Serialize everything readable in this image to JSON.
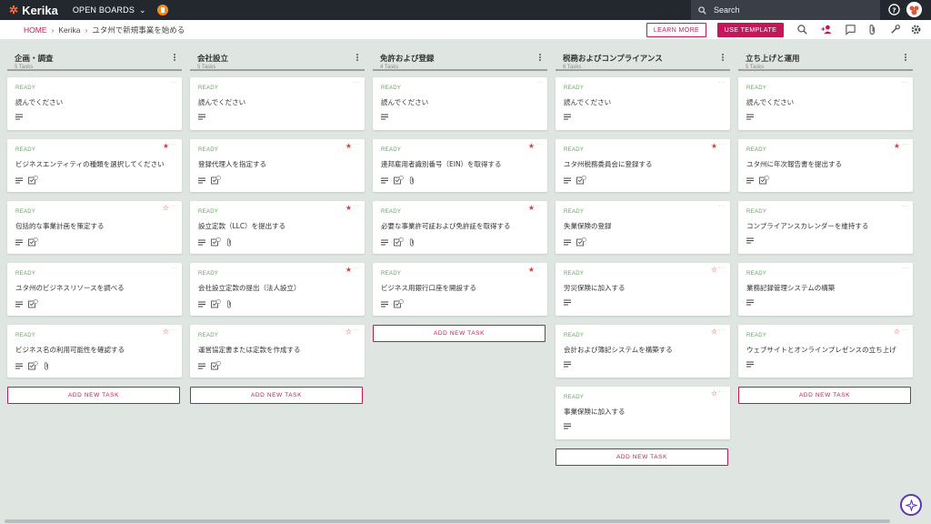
{
  "topbar": {
    "logo": "Kerika",
    "open_boards": "OPEN BOARDS",
    "search_placeholder": "Search"
  },
  "subbar": {
    "breadcrumb": [
      "HOME",
      "Kerika",
      "ユタ州で新規事業を始める"
    ],
    "learn_more": "LEARN MORE",
    "use_template": "USE TEMPLATE"
  },
  "colors": {
    "accent": "#c2185b",
    "status_ready": "#5fa65a",
    "star": "#e53935",
    "topbar": "#23272e",
    "background": "#dfe6e2"
  },
  "add_task_label": "ADD NEW TASK",
  "columns": [
    {
      "title": "企画・調査",
      "count": "5 Tasks",
      "tasks": [
        {
          "status": "READY",
          "title": "読んでください",
          "star": "none",
          "icons": [
            "desc"
          ]
        },
        {
          "status": "READY",
          "title": "ビジネスエンティティの種類を選択してください",
          "star": "filled",
          "icons": [
            "desc",
            "checklist"
          ]
        },
        {
          "status": "READY",
          "title": "包括的な事業計画を策定する",
          "star": "outline",
          "icons": [
            "desc",
            "checklist"
          ]
        },
        {
          "status": "READY",
          "title": "ユタ州のビジネスリソースを調べる",
          "star": "none",
          "icons": [
            "desc",
            "checklist"
          ]
        },
        {
          "status": "READY",
          "title": "ビジネス名の利用可能性を確認する",
          "star": "outline",
          "icons": [
            "desc",
            "checklist",
            "attach"
          ]
        }
      ]
    },
    {
      "title": "会社設立",
      "count": "5 Tasks",
      "tasks": [
        {
          "status": "READY",
          "title": "読んでください",
          "star": "none",
          "icons": [
            "desc"
          ]
        },
        {
          "status": "READY",
          "title": "登録代理人を指定する",
          "star": "filled",
          "icons": [
            "desc",
            "checklist"
          ]
        },
        {
          "status": "READY",
          "title": "設立定款（LLC）を提出する",
          "star": "filled",
          "icons": [
            "desc",
            "checklist",
            "attach"
          ]
        },
        {
          "status": "READY",
          "title": "会社設立定款の提出（法人設立）",
          "star": "filled",
          "icons": [
            "desc",
            "checklist",
            "attach"
          ]
        },
        {
          "status": "READY",
          "title": "運営協定書または定款を作成する",
          "star": "outline",
          "icons": [
            "desc",
            "checklist"
          ]
        }
      ]
    },
    {
      "title": "免許および登録",
      "count": "4 Tasks",
      "tasks": [
        {
          "status": "READY",
          "title": "読んでください",
          "star": "none",
          "icons": [
            "desc"
          ]
        },
        {
          "status": "READY",
          "title": "連邦雇用者識別番号（EIN）を取得する",
          "star": "filled",
          "icons": [
            "desc",
            "checklist",
            "attach"
          ]
        },
        {
          "status": "READY",
          "title": "必要な事業許可証および免許証を取得する",
          "star": "filled",
          "icons": [
            "desc",
            "checklist",
            "attach"
          ]
        },
        {
          "status": "READY",
          "title": "ビジネス用銀行口座を開設する",
          "star": "filled",
          "icons": [
            "desc",
            "checklist"
          ]
        }
      ]
    },
    {
      "title": "税務およびコンプライアンス",
      "count": "6 Tasks",
      "tasks": [
        {
          "status": "READY",
          "title": "読んでください",
          "star": "none",
          "icons": [
            "desc"
          ]
        },
        {
          "status": "READY",
          "title": "ユタ州税務委員会に登録する",
          "star": "filled",
          "icons": [
            "desc",
            "checklist"
          ]
        },
        {
          "status": "READY",
          "title": "失業保険の登録",
          "star": "none",
          "icons": [
            "desc",
            "checklist"
          ]
        },
        {
          "status": "READY",
          "title": "労災保険に加入する",
          "star": "outline",
          "icons": [
            "desc"
          ]
        },
        {
          "status": "READY",
          "title": "会計および簿記システムを構築する",
          "star": "outline",
          "icons": [
            "desc"
          ]
        },
        {
          "status": "READY",
          "title": "事業保険に加入する",
          "star": "outline",
          "icons": [
            "desc"
          ]
        }
      ]
    },
    {
      "title": "立ち上げと運用",
      "count": "5 Tasks",
      "tasks": [
        {
          "status": "READY",
          "title": "読んでください",
          "star": "none",
          "icons": [
            "desc"
          ]
        },
        {
          "status": "READY",
          "title": "ユタ州に年次報告書を提出する",
          "star": "filled",
          "icons": [
            "desc",
            "checklist"
          ]
        },
        {
          "status": "READY",
          "title": "コンプライアンスカレンダーを維持する",
          "star": "none",
          "icons": [
            "desc"
          ]
        },
        {
          "status": "READY",
          "title": "業務記録管理システムの構築",
          "star": "none",
          "icons": [
            "desc"
          ]
        },
        {
          "status": "READY",
          "title": "ウェブサイトとオンラインプレゼンスの立ち上げ",
          "star": "outline",
          "icons": [
            "desc"
          ]
        }
      ]
    }
  ]
}
